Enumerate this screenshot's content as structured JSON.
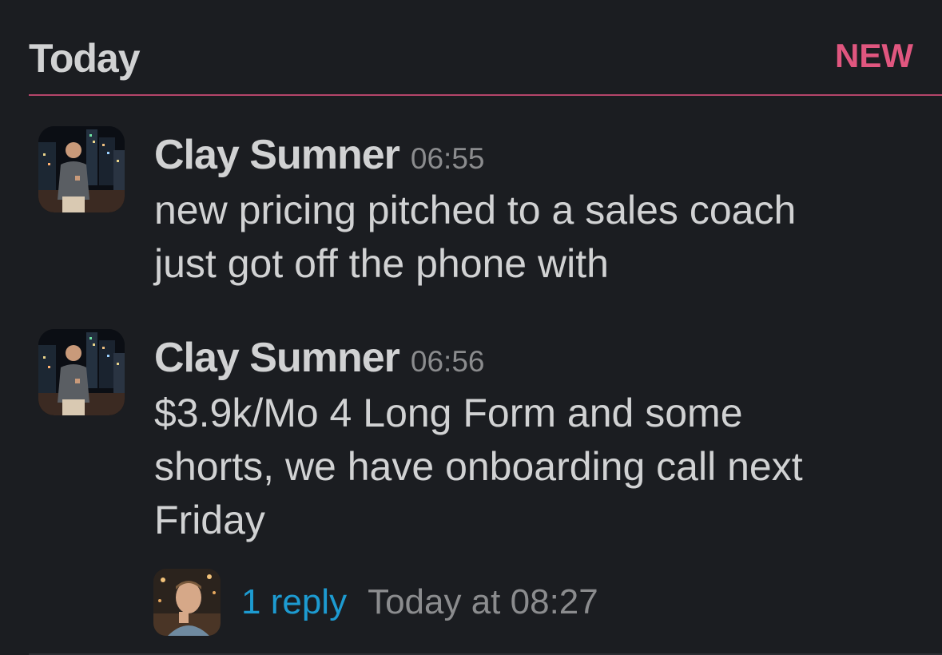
{
  "divider": {
    "day": "Today",
    "new_badge": "NEW"
  },
  "messages": [
    {
      "sender": "Clay Sumner",
      "time": "06:55",
      "lines": [
        "new pricing pitched to a sales coach",
        "just got off the phone with"
      ]
    },
    {
      "sender": "Clay Sumner",
      "time": "06:56",
      "lines": [
        "$3.9k/Mo 4 Long Form and some",
        "shorts, we have onboarding call next",
        "Friday"
      ]
    }
  ],
  "thread": {
    "reply_count": "1 reply",
    "last_reply": "Today at 08:27"
  },
  "colors": {
    "background": "#1b1d21",
    "text": "#d1d2d3",
    "muted": "#8b8c8e",
    "new_accent": "#e0567f",
    "link": "#1d9bd1"
  }
}
